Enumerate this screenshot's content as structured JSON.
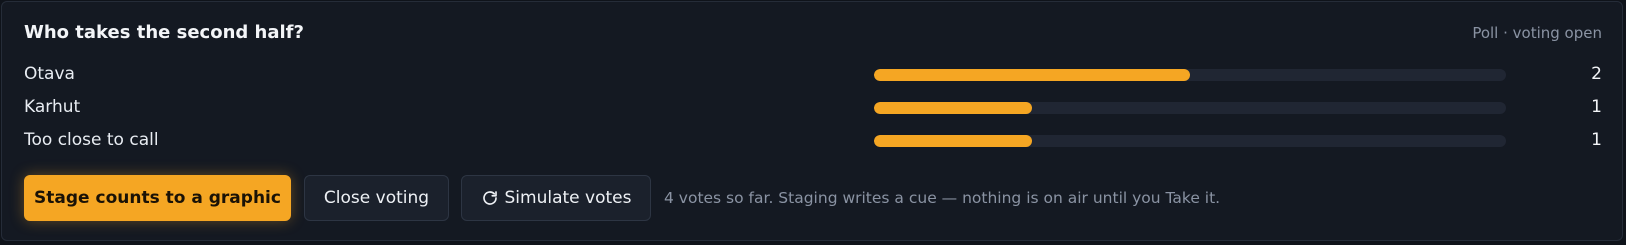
{
  "poll": {
    "question": "Who takes the second half?",
    "status": "Poll · voting open",
    "options": [
      {
        "label": "Otava",
        "count": "2",
        "share": 0.5
      },
      {
        "label": "Karhut",
        "count": "1",
        "share": 0.25
      },
      {
        "label": "Too close to call",
        "count": "1",
        "share": 0.25
      }
    ]
  },
  "actions": {
    "stage_label": "Stage counts to a graphic",
    "close_label": "Close voting",
    "simulate_label": "Simulate votes",
    "simulate_icon": "refresh-icon"
  },
  "hint": "4 votes so far. Staging writes a cue — nothing is on air until you Take it.",
  "colors": {
    "accent": "#f5a623",
    "track": "#202633",
    "panel": "#141922"
  }
}
